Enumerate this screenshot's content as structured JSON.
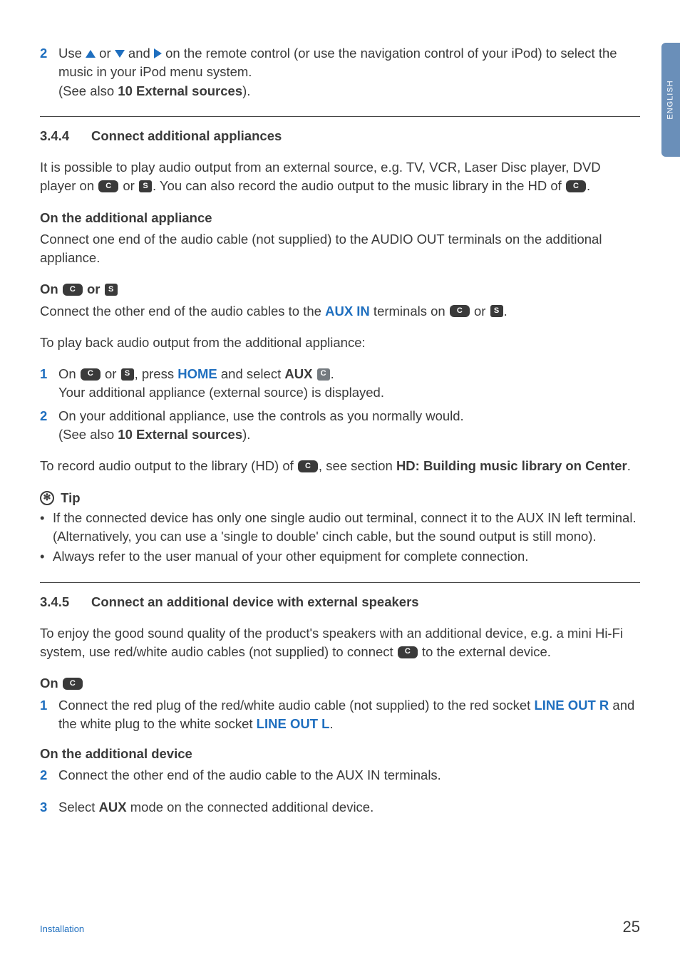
{
  "tab": "ENGLISH",
  "intro": {
    "step_num": "2",
    "line1a": "Use ",
    "line1b": " or ",
    "line1c": " and ",
    "line1d": " on the remote control (or use the navigation control of your iPod) to select the music in your iPod menu system.",
    "line2a": "(See also ",
    "line2b": "10 External sources",
    "line2c": ")."
  },
  "s344": {
    "num": "3.4.4",
    "title": "Connect additional appliances",
    "p1a": "It is possible to play audio output from an external source, e.g. TV,  VCR, Laser Disc player, DVD player on ",
    "p1b": " or ",
    "p1c": ". You can also record the audio output to the music library in the HD of ",
    "p1d": ".",
    "sub1": "On the additional appliance",
    "p2": "Connect one end of the audio cable (not supplied) to the AUDIO OUT terminals on the additional appliance.",
    "sub2a": "On ",
    "sub2b": " or ",
    "p3a": "Connect the other end of the audio cables to the ",
    "p3_aux": "AUX IN",
    "p3b": " terminals on ",
    "p3c": " or ",
    "p3d": ".",
    "p4": "To play back audio output from the additional appliance:",
    "st1_num": "1",
    "st1a": "On ",
    "st1b": " or ",
    "st1c": ", press ",
    "st1_home": "HOME",
    "st1d": " and select ",
    "st1_aux": "AUX",
    "st1e": " ",
    "st1f": ".",
    "st1g": "Your additional appliance (external source) is displayed.",
    "st2_num": "2",
    "st2a": "On your additional appliance, use the controls as you normally would.",
    "st2b": "(See also ",
    "st2c": "10 External sources",
    "st2d": ").",
    "p5a": "To record audio output to the library (HD) of ",
    "p5b": ", see section ",
    "p5c": "HD: Building music library on Center",
    "p5d": ".",
    "tip_label": "Tip",
    "tip1": "If the connected device has only one single audio out terminal, connect it to the AUX IN left terminal. (Alternatively, you can use a 'single to double' cinch cable, but the sound output is still mono).",
    "tip2": "Always refer to the user manual of your other equipment for complete connection."
  },
  "s345": {
    "num": "3.4.5",
    "title": "Connect an additional device with external speakers",
    "p1a": "To enjoy the good sound quality of the product's speakers with an additional device, e.g. a mini Hi-Fi system, use red/white audio cables (not supplied) to connect ",
    "p1b": " to the external device.",
    "sub1": "On ",
    "st1_num": "1",
    "st1a": "Connect the red plug of the red/white audio cable (not supplied) to the red socket ",
    "st1_r": "LINE OUT R",
    "st1b": " and the white plug to the white socket ",
    "st1_l": "LINE OUT L",
    "st1c": ".",
    "sub2": "On the additional device",
    "st2_num": "2",
    "st2": "Connect the other end of the audio cable to the AUX IN terminals.",
    "st3_num": "3",
    "st3a": "Select ",
    "st3b": "AUX",
    "st3c": " mode on the connected additional device."
  },
  "footer": {
    "section": "Installation",
    "page": "25"
  },
  "dev": {
    "c": "C",
    "s": "S"
  }
}
